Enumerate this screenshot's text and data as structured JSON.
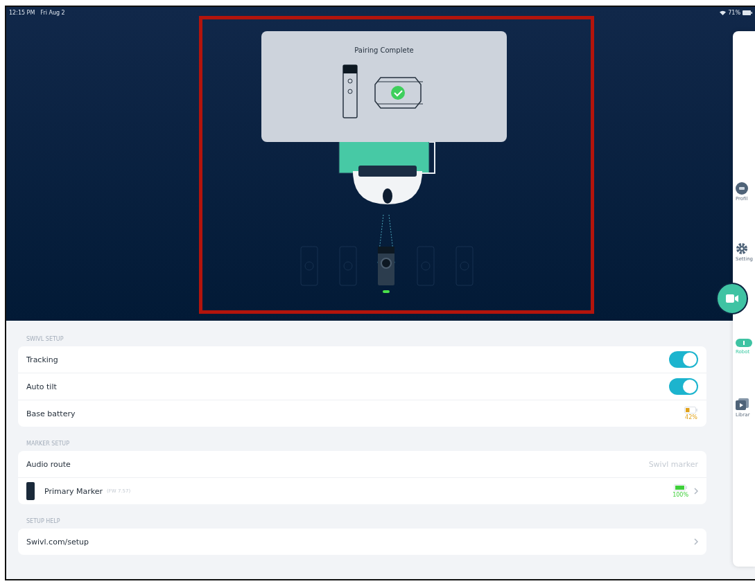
{
  "status_bar": {
    "time": "12:15 PM",
    "date": "Fri Aug 2",
    "battery": "71%"
  },
  "popup": {
    "title": "Pairing Complete"
  },
  "sidebar": {
    "items": [
      {
        "label": "Profil",
        "selected": false
      },
      {
        "label": "Setting",
        "selected": false
      },
      {
        "label": "Robot",
        "selected": true
      },
      {
        "label": "Librar",
        "selected": false
      }
    ]
  },
  "sections": [
    {
      "title": "SWIVL SETUP",
      "rows": [
        {
          "kind": "toggle",
          "label": "Tracking",
          "on": true
        },
        {
          "kind": "toggle",
          "label": "Auto tilt",
          "on": true
        },
        {
          "kind": "battery",
          "label": "Base battery",
          "level": 0.42,
          "reading": "42%"
        }
      ]
    },
    {
      "title": "MARKER SETUP",
      "rows": [
        {
          "kind": "value",
          "label": "Audio route",
          "value": "Swivl marker"
        },
        {
          "kind": "marker",
          "label": "Primary Marker",
          "version": "(FW 7.57)",
          "level": 1,
          "reading": "100%"
        }
      ]
    },
    {
      "title": "SETUP HELP",
      "rows": [
        {
          "kind": "link",
          "label": "Swivl.com/setup"
        }
      ]
    }
  ]
}
